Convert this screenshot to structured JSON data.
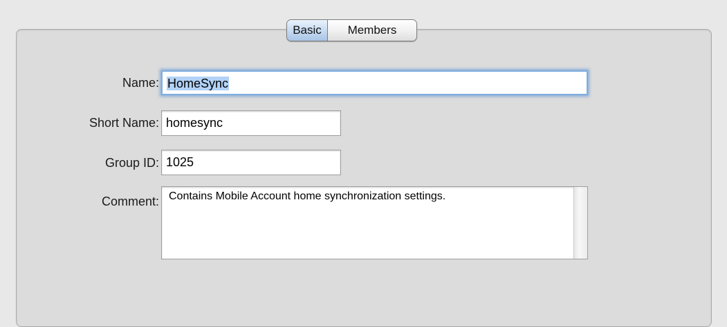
{
  "tabs": {
    "basic": "Basic",
    "members": "Members"
  },
  "form": {
    "name_label": "Name:",
    "name_value": "HomeSync",
    "short_name_label": "Short Name:",
    "short_name_value": "homesync",
    "group_id_label": "Group ID:",
    "group_id_value": "1025",
    "comment_label": "Comment:",
    "comment_value": "Contains Mobile Account home synchronization settings."
  },
  "colors": {
    "selected_tab": "#c5d9f0",
    "focus_ring": "#7faedd",
    "text_selection": "#b2d2f7"
  }
}
